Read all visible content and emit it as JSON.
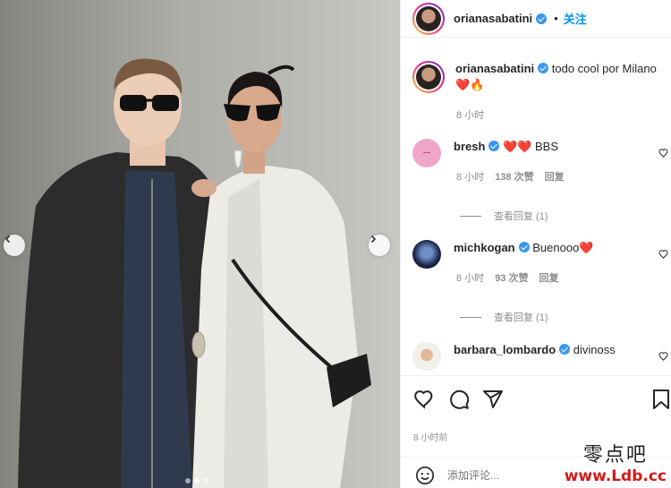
{
  "post": {
    "author": "orianasabatini",
    "follow_label": "关注",
    "caption_author": "orianasabatini",
    "caption_text": "todo cool por Milano",
    "caption_emoji": "❤️🔥",
    "caption_time": "8 小时",
    "posted_ago": "8 小时前",
    "carousel": {
      "slide_count": 3,
      "active_slide": 2
    }
  },
  "comments": [
    {
      "user": "bresh",
      "text": "❤️❤️ BBS",
      "time": "8 小时",
      "likes": "138 次赞",
      "reply_label": "回复",
      "view_replies": "查看回复 (1)"
    },
    {
      "user": "michkogan",
      "text": "Buenooo❤️",
      "time": "8 小时",
      "likes": "93 次赞",
      "reply_label": "回复",
      "view_replies": "查看回复 (1)"
    },
    {
      "user": "barbara_lombardo",
      "text": "divinoss"
    }
  ],
  "add_comment": {
    "placeholder": "添加评论..."
  },
  "watermark": {
    "line1": "零点吧",
    "line2": "www.Ldb.cc"
  },
  "colors": {
    "link": "#0095f6",
    "verified": "#3897f0",
    "meta": "#8e8e8e",
    "watermark_red": "#d11a1a"
  },
  "icons": [
    "heart-icon",
    "comment-icon",
    "share-icon",
    "bookmark-icon",
    "smile-icon",
    "chevron-left-icon",
    "chevron-right-icon",
    "verified-badge-icon"
  ]
}
